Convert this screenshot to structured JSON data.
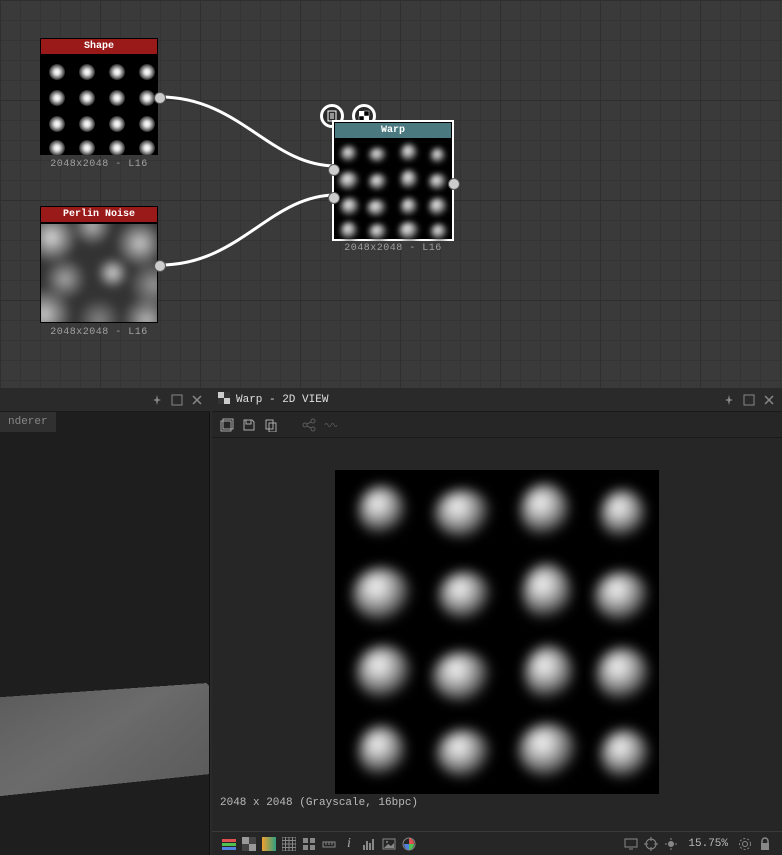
{
  "graph": {
    "nodes": {
      "shape": {
        "title": "Shape",
        "footer": "2048x2048 - L16"
      },
      "noise": {
        "title": "Perlin Noise",
        "footer": "2048x2048 - L16"
      },
      "warp": {
        "title": "Warp",
        "footer": "2048x2048 - L16"
      }
    }
  },
  "panel_left": {
    "tab_suffix": "nderer"
  },
  "viewer": {
    "title": "Warp - 2D VIEW",
    "info": "2048 x 2048 (Grayscale, 16bpc)",
    "zoom": "15.75%"
  }
}
